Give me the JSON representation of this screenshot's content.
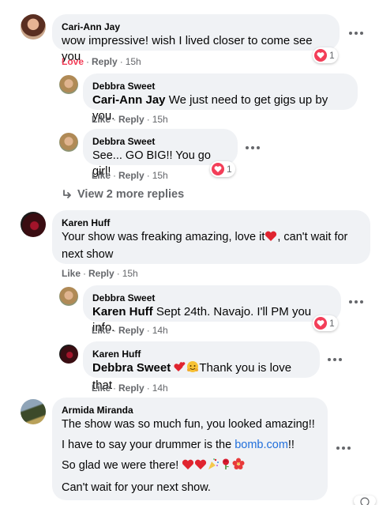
{
  "comments": [
    {
      "author": "Cari-Ann Jay",
      "text": "wow impressive! wish I lived closer to come see you",
      "actions": {
        "primary": "Love",
        "reply": "Reply",
        "time": "15h"
      },
      "reaction_count": "1"
    },
    {
      "author": "Debbra Sweet",
      "mention": "Cari-Ann Jay",
      "text": "We just need to get gigs up by you.",
      "actions": {
        "primary": "Like",
        "reply": "Reply",
        "time": "15h"
      }
    },
    {
      "author": "Debbra Sweet",
      "text": "See... GO BIG!! You go girl!",
      "actions": {
        "primary": "Like",
        "reply": "Reply",
        "time": "15h"
      },
      "reaction_count": "1"
    },
    {
      "author": "Karen Huff",
      "text_1": "Your show was freaking amazing, love it",
      "text_2": ", can't wait for",
      "text_3": "next show",
      "actions": {
        "primary": "Like",
        "reply": "Reply",
        "time": "15h"
      }
    },
    {
      "author": "Debbra Sweet",
      "mention": "Karen Huff",
      "text": "Sept 24th. Navajo. I'll PM you info.",
      "actions": {
        "primary": "Like",
        "reply": "Reply",
        "time": "14h"
      },
      "reaction_count": "1"
    },
    {
      "author": "Karen Huff",
      "mention": "Debbra Sweet",
      "text": "Thank you is love that",
      "actions": {
        "primary": "Like",
        "reply": "Reply",
        "time": "14h"
      }
    },
    {
      "author": "Armida Miranda",
      "line_1": "The show was so much fun, you looked amazing!!",
      "line_2_prefix": "I have to say your drummer is the ",
      "line_2_link": "bomb.com",
      "line_2_suffix": "!!",
      "line_3": "So glad we were there!",
      "line_4": "Can't wait for your next show."
    }
  ],
  "view_more_replies": "View 2 more replies",
  "colors": {
    "bubble": "#f0f2f5",
    "secondary_text": "#65676b",
    "love": "#f33e58",
    "link": "#216fdb"
  },
  "icons": [
    "more-options-icon",
    "heart-reaction-icon",
    "reply-arrow-icon",
    "heart-emoji",
    "kissing-hearts-emoji",
    "hugging-emoji",
    "confetti-emoji",
    "rose-emoji",
    "hibiscus-emoji"
  ]
}
